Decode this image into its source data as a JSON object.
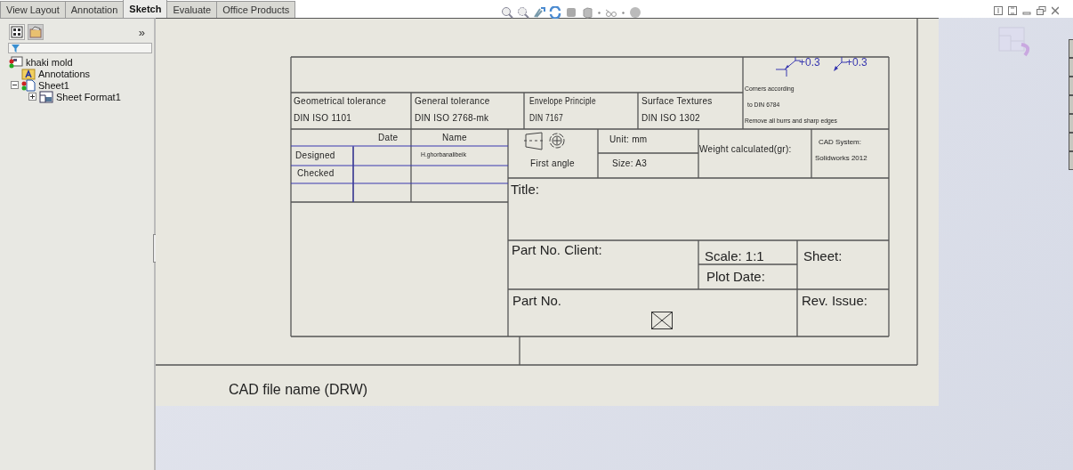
{
  "tabs": [
    {
      "label": "View Layout",
      "selected": false
    },
    {
      "label": "Annotation",
      "selected": false
    },
    {
      "label": "Sketch",
      "selected": true
    },
    {
      "label": "Evaluate",
      "selected": false
    },
    {
      "label": "Office Products",
      "selected": false
    }
  ],
  "panel": {
    "collapse": "»"
  },
  "tree": [
    {
      "label": "khaki mold",
      "kind": "part",
      "children": [
        {
          "label": "Annotations",
          "kind": "annotations"
        },
        {
          "label": "Sheet1",
          "kind": "sheet",
          "expanded": true,
          "children": [
            {
              "label": "Sheet Format1",
              "kind": "format",
              "expanded": false
            }
          ]
        }
      ]
    }
  ],
  "title_block": {
    "tolerances": [
      {
        "label": "Geometrical tolerance",
        "standard": "DIN ISO 1101"
      },
      {
        "label": "General tolerance",
        "standard": "DIN ISO 2768-mk"
      },
      {
        "label": "Envelope Principle",
        "standard": "DIN 7167"
      },
      {
        "label": "Surface Textures",
        "standard": "DIN ISO 1302"
      }
    ],
    "corner_values": [
      "+0.3",
      "+0.3"
    ],
    "corner_notes": [
      "Corners according",
      "to DIN 6784",
      "Remove all burrs and sharp edges"
    ],
    "headers": [
      "Date",
      "Name"
    ],
    "roles": [
      {
        "label": "Designed",
        "name": "H.ghorbanalibeik"
      },
      {
        "label": "Checked"
      }
    ],
    "projection": "First angle",
    "unit": "Unit: mm",
    "size": "Size: A3",
    "weight": "Weight calculated(gr):",
    "cad_system": [
      "CAD System:",
      "Solidworks 2012"
    ],
    "title": "Title:",
    "part_no_client": "Part No. Client:",
    "scale": "Scale: 1:1",
    "plot_date": "Plot Date:",
    "sheet": "Sheet:",
    "part_no": "Part No.",
    "rev_issue": "Rev. Issue:"
  },
  "cad_file_name": "CAD file name (DRW)"
}
